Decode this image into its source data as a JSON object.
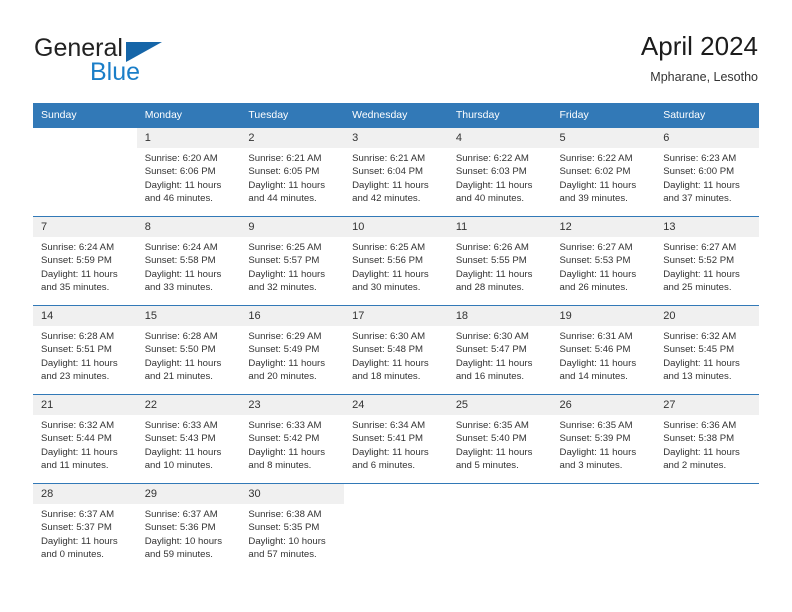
{
  "logo": {
    "word_top": "General",
    "word_bottom": "Blue",
    "triangle_icon": "blue-triangle-icon",
    "blue": "#1a7ec8",
    "dark_blue": "#1565a8"
  },
  "header": {
    "title": "April 2024",
    "subtitle": "Mpharane, Lesotho"
  },
  "theme": {
    "header_bg": "#3279b7",
    "header_text": "#ffffff",
    "daynum_bg": "#f0f0f0",
    "cell_bg": "#ffffff",
    "row_rule": "#3279b7"
  },
  "columns": [
    "Sunday",
    "Monday",
    "Tuesday",
    "Wednesday",
    "Thursday",
    "Friday",
    "Saturday"
  ],
  "weeks": [
    [
      {
        "day": "",
        "sunrise": "",
        "sunset": "",
        "daylight_line1": "",
        "daylight_line2": ""
      },
      {
        "day": "1",
        "sunrise": "Sunrise: 6:20 AM",
        "sunset": "Sunset: 6:06 PM",
        "daylight_line1": "Daylight: 11 hours",
        "daylight_line2": "and 46 minutes."
      },
      {
        "day": "2",
        "sunrise": "Sunrise: 6:21 AM",
        "sunset": "Sunset: 6:05 PM",
        "daylight_line1": "Daylight: 11 hours",
        "daylight_line2": "and 44 minutes."
      },
      {
        "day": "3",
        "sunrise": "Sunrise: 6:21 AM",
        "sunset": "Sunset: 6:04 PM",
        "daylight_line1": "Daylight: 11 hours",
        "daylight_line2": "and 42 minutes."
      },
      {
        "day": "4",
        "sunrise": "Sunrise: 6:22 AM",
        "sunset": "Sunset: 6:03 PM",
        "daylight_line1": "Daylight: 11 hours",
        "daylight_line2": "and 40 minutes."
      },
      {
        "day": "5",
        "sunrise": "Sunrise: 6:22 AM",
        "sunset": "Sunset: 6:02 PM",
        "daylight_line1": "Daylight: 11 hours",
        "daylight_line2": "and 39 minutes."
      },
      {
        "day": "6",
        "sunrise": "Sunrise: 6:23 AM",
        "sunset": "Sunset: 6:00 PM",
        "daylight_line1": "Daylight: 11 hours",
        "daylight_line2": "and 37 minutes."
      }
    ],
    [
      {
        "day": "7",
        "sunrise": "Sunrise: 6:24 AM",
        "sunset": "Sunset: 5:59 PM",
        "daylight_line1": "Daylight: 11 hours",
        "daylight_line2": "and 35 minutes."
      },
      {
        "day": "8",
        "sunrise": "Sunrise: 6:24 AM",
        "sunset": "Sunset: 5:58 PM",
        "daylight_line1": "Daylight: 11 hours",
        "daylight_line2": "and 33 minutes."
      },
      {
        "day": "9",
        "sunrise": "Sunrise: 6:25 AM",
        "sunset": "Sunset: 5:57 PM",
        "daylight_line1": "Daylight: 11 hours",
        "daylight_line2": "and 32 minutes."
      },
      {
        "day": "10",
        "sunrise": "Sunrise: 6:25 AM",
        "sunset": "Sunset: 5:56 PM",
        "daylight_line1": "Daylight: 11 hours",
        "daylight_line2": "and 30 minutes."
      },
      {
        "day": "11",
        "sunrise": "Sunrise: 6:26 AM",
        "sunset": "Sunset: 5:55 PM",
        "daylight_line1": "Daylight: 11 hours",
        "daylight_line2": "and 28 minutes."
      },
      {
        "day": "12",
        "sunrise": "Sunrise: 6:27 AM",
        "sunset": "Sunset: 5:53 PM",
        "daylight_line1": "Daylight: 11 hours",
        "daylight_line2": "and 26 minutes."
      },
      {
        "day": "13",
        "sunrise": "Sunrise: 6:27 AM",
        "sunset": "Sunset: 5:52 PM",
        "daylight_line1": "Daylight: 11 hours",
        "daylight_line2": "and 25 minutes."
      }
    ],
    [
      {
        "day": "14",
        "sunrise": "Sunrise: 6:28 AM",
        "sunset": "Sunset: 5:51 PM",
        "daylight_line1": "Daylight: 11 hours",
        "daylight_line2": "and 23 minutes."
      },
      {
        "day": "15",
        "sunrise": "Sunrise: 6:28 AM",
        "sunset": "Sunset: 5:50 PM",
        "daylight_line1": "Daylight: 11 hours",
        "daylight_line2": "and 21 minutes."
      },
      {
        "day": "16",
        "sunrise": "Sunrise: 6:29 AM",
        "sunset": "Sunset: 5:49 PM",
        "daylight_line1": "Daylight: 11 hours",
        "daylight_line2": "and 20 minutes."
      },
      {
        "day": "17",
        "sunrise": "Sunrise: 6:30 AM",
        "sunset": "Sunset: 5:48 PM",
        "daylight_line1": "Daylight: 11 hours",
        "daylight_line2": "and 18 minutes."
      },
      {
        "day": "18",
        "sunrise": "Sunrise: 6:30 AM",
        "sunset": "Sunset: 5:47 PM",
        "daylight_line1": "Daylight: 11 hours",
        "daylight_line2": "and 16 minutes."
      },
      {
        "day": "19",
        "sunrise": "Sunrise: 6:31 AM",
        "sunset": "Sunset: 5:46 PM",
        "daylight_line1": "Daylight: 11 hours",
        "daylight_line2": "and 14 minutes."
      },
      {
        "day": "20",
        "sunrise": "Sunrise: 6:32 AM",
        "sunset": "Sunset: 5:45 PM",
        "daylight_line1": "Daylight: 11 hours",
        "daylight_line2": "and 13 minutes."
      }
    ],
    [
      {
        "day": "21",
        "sunrise": "Sunrise: 6:32 AM",
        "sunset": "Sunset: 5:44 PM",
        "daylight_line1": "Daylight: 11 hours",
        "daylight_line2": "and 11 minutes."
      },
      {
        "day": "22",
        "sunrise": "Sunrise: 6:33 AM",
        "sunset": "Sunset: 5:43 PM",
        "daylight_line1": "Daylight: 11 hours",
        "daylight_line2": "and 10 minutes."
      },
      {
        "day": "23",
        "sunrise": "Sunrise: 6:33 AM",
        "sunset": "Sunset: 5:42 PM",
        "daylight_line1": "Daylight: 11 hours",
        "daylight_line2": "and 8 minutes."
      },
      {
        "day": "24",
        "sunrise": "Sunrise: 6:34 AM",
        "sunset": "Sunset: 5:41 PM",
        "daylight_line1": "Daylight: 11 hours",
        "daylight_line2": "and 6 minutes."
      },
      {
        "day": "25",
        "sunrise": "Sunrise: 6:35 AM",
        "sunset": "Sunset: 5:40 PM",
        "daylight_line1": "Daylight: 11 hours",
        "daylight_line2": "and 5 minutes."
      },
      {
        "day": "26",
        "sunrise": "Sunrise: 6:35 AM",
        "sunset": "Sunset: 5:39 PM",
        "daylight_line1": "Daylight: 11 hours",
        "daylight_line2": "and 3 minutes."
      },
      {
        "day": "27",
        "sunrise": "Sunrise: 6:36 AM",
        "sunset": "Sunset: 5:38 PM",
        "daylight_line1": "Daylight: 11 hours",
        "daylight_line2": "and 2 minutes."
      }
    ],
    [
      {
        "day": "28",
        "sunrise": "Sunrise: 6:37 AM",
        "sunset": "Sunset: 5:37 PM",
        "daylight_line1": "Daylight: 11 hours",
        "daylight_line2": "and 0 minutes."
      },
      {
        "day": "29",
        "sunrise": "Sunrise: 6:37 AM",
        "sunset": "Sunset: 5:36 PM",
        "daylight_line1": "Daylight: 10 hours",
        "daylight_line2": "and 59 minutes."
      },
      {
        "day": "30",
        "sunrise": "Sunrise: 6:38 AM",
        "sunset": "Sunset: 5:35 PM",
        "daylight_line1": "Daylight: 10 hours",
        "daylight_line2": "and 57 minutes."
      },
      {
        "day": "",
        "sunrise": "",
        "sunset": "",
        "daylight_line1": "",
        "daylight_line2": ""
      },
      {
        "day": "",
        "sunrise": "",
        "sunset": "",
        "daylight_line1": "",
        "daylight_line2": ""
      },
      {
        "day": "",
        "sunrise": "",
        "sunset": "",
        "daylight_line1": "",
        "daylight_line2": ""
      },
      {
        "day": "",
        "sunrise": "",
        "sunset": "",
        "daylight_line1": "",
        "daylight_line2": ""
      }
    ]
  ]
}
